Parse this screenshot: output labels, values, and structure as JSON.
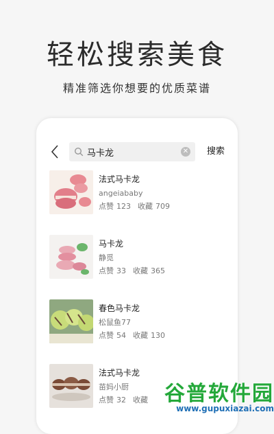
{
  "hero": {
    "title": "轻松搜索美食",
    "subtitle": "精准筛选你想要的优质菜谱"
  },
  "search": {
    "query": "马卡龙",
    "submit_label": "搜索",
    "back_icon": "chevron-left-icon",
    "search_icon": "search-icon",
    "clear_icon": "clear-icon"
  },
  "results": [
    {
      "title": "法式马卡龙",
      "author": "angeiababy",
      "likes_label": "点赞",
      "likes": "123",
      "favs_label": "收藏",
      "favs": "709"
    },
    {
      "title": "马卡龙",
      "author": "静觅",
      "likes_label": "点赞",
      "likes": "33",
      "favs_label": "收藏",
      "favs": "365"
    },
    {
      "title": "春色马卡龙",
      "author": "松鼠鱼77",
      "likes_label": "点赞",
      "likes": "54",
      "favs_label": "收藏",
      "favs": "130"
    },
    {
      "title": "法式马卡龙",
      "author": "苗妈小厨",
      "likes_label": "点赞",
      "likes": "32",
      "favs_label": "收藏",
      "favs": ""
    }
  ],
  "watermark": {
    "name": "谷普软件园",
    "url": "www.gupuxiazai.com"
  },
  "colors": {
    "watermark_green": "#24a83a",
    "watermark_blue": "#1f6fb5"
  }
}
